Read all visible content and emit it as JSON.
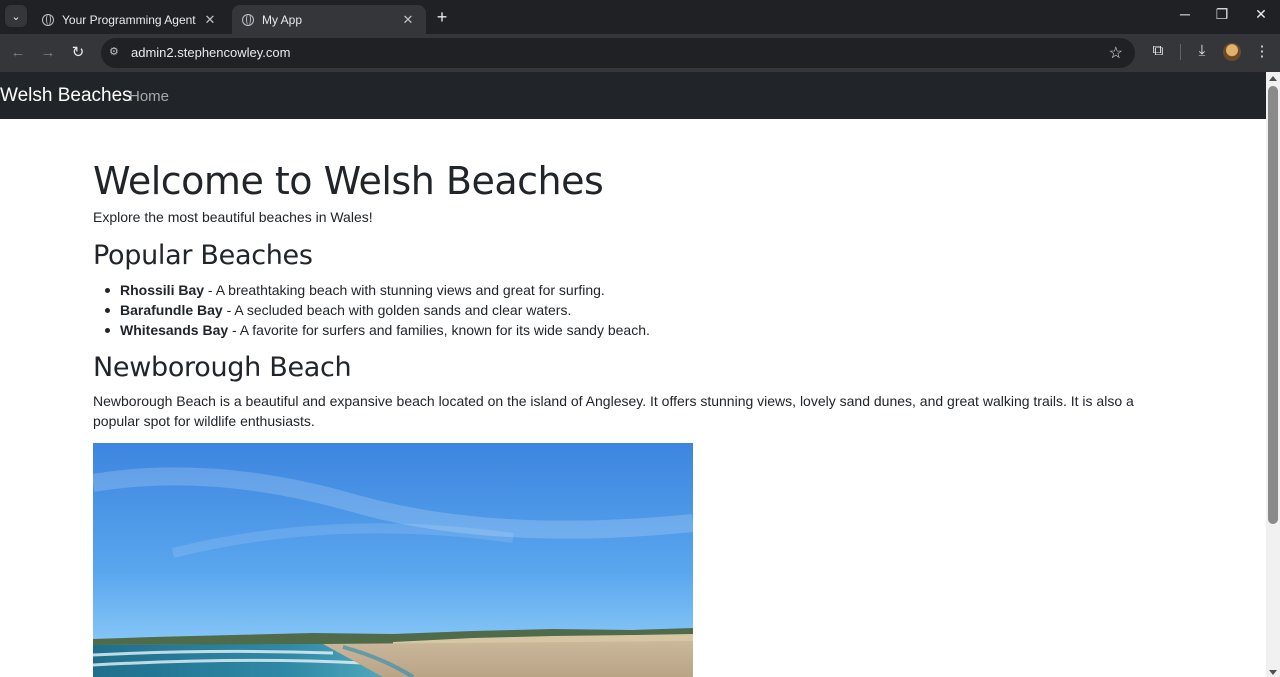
{
  "browser": {
    "tabs": [
      {
        "title": "Your Programming Agent",
        "active": false
      },
      {
        "title": "My App",
        "active": true
      }
    ],
    "new_tab_glyph": "+",
    "tab_close_glyph": "✕",
    "url": "admin2.stephencowley.com",
    "window_controls": {
      "minimize": "─",
      "restore": "❐",
      "close": "✕"
    },
    "nav": {
      "back": "←",
      "forward": "→",
      "reload": "↻"
    },
    "icons": {
      "site_info": "⚙",
      "bookmark": "☆",
      "extensions": "⧉",
      "download": "⤓",
      "menu": "⋮",
      "tab_search": "⌄"
    }
  },
  "site": {
    "brand": "Welsh Beaches",
    "nav_links": [
      "Home"
    ],
    "colors": {
      "navbar": "#212529",
      "text": "#212529"
    }
  },
  "main": {
    "heading": "Welcome to Welsh Beaches",
    "lead": "Explore the most beautiful beaches in Wales!",
    "popular_heading": "Popular Beaches",
    "beaches": [
      {
        "name": "Rhossili Bay",
        "description": " - A breathtaking beach with stunning views and great for surfing."
      },
      {
        "name": "Barafundle Bay",
        "description": " - A secluded beach with golden sands and clear waters."
      },
      {
        "name": "Whitesands Bay",
        "description": " - A favorite for surfers and families, known for its wide sandy beach."
      }
    ],
    "feature_heading": "Newborough Beach",
    "feature_text": "Newborough Beach is a beautiful and expansive beach located on the island of Anglesey. It offers stunning views, lovely sand dunes, and great walking trails. It is also a popular spot for wildlife enthusiasts.",
    "feature_image": "newborough-beach-photo"
  }
}
